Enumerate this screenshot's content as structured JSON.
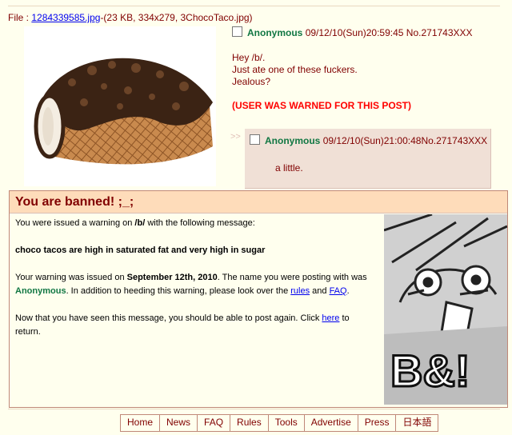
{
  "file": {
    "prefix": "File : ",
    "link": "1284339585.jpg",
    "meta": "-(23 KB, 334x279, 3ChocoTaco.jpg)"
  },
  "op": {
    "name": "Anonymous",
    "datetime": "09/12/10(Sun)20:59:45",
    "postno": "No.271743XXX",
    "lines": [
      "Hey /b/.",
      "Just ate one of these fuckers.",
      "Jealous?"
    ],
    "warning": "(USER WAS WARNED FOR THIS POST)"
  },
  "reply": {
    "arrows": ">>",
    "name": "Anonymous",
    "datetime": "09/12/10(Sun)21:00:48",
    "postno": "No.271743XXX",
    "text": "a little."
  },
  "ban": {
    "title": "You are banned! ;_;",
    "p1_a": "You were issued a warning on ",
    "p1_board": "/b/",
    "p1_b": " with the following message:",
    "message": "choco tacos are high in saturated fat and very high in sugar",
    "p3_a": "Your warning was issued on ",
    "p3_date": "September 12th, 2010",
    "p3_b": ". The name you were posting with was ",
    "p3_name": "Anonymous",
    "p3_c": ". In addition to heeding this warning, please look over the ",
    "rules_link": "rules",
    "p3_d": " and ",
    "faq_link": "FAQ",
    "p3_e": ".",
    "p4_a": "Now that you have seen this message, you should be able to post again. Click ",
    "here_link": "here",
    "p4_b": " to return.",
    "image_text": "B&!"
  },
  "nav": [
    "Home",
    "News",
    "FAQ",
    "Rules",
    "Tools",
    "Advertise",
    "Press",
    "日本語"
  ],
  "colors": {
    "background": "#FFFFEE",
    "text": "#800000",
    "name": "#117743",
    "link": "#0000EE",
    "warning": "#FF0000",
    "reply_bg": "#F0E0D6",
    "ban_header": "#FEDCBA"
  }
}
